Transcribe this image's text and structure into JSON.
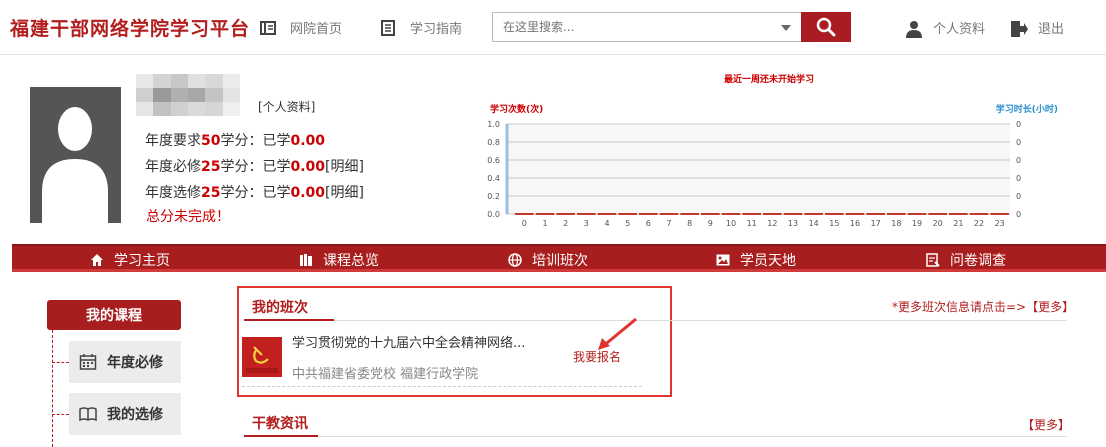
{
  "header": {
    "site_title": "福建干部网络学院学习平台",
    "nav": [
      {
        "label": "网院首页",
        "icon": "book-icon"
      },
      {
        "label": "学习指南",
        "icon": "guide-icon"
      }
    ],
    "search": {
      "placeholder": "在这里搜索...",
      "value": ""
    },
    "profile_label": "个人资料",
    "logout_label": "退出"
  },
  "profile": {
    "profile_link": "[个人资料]",
    "annual_required_prefix": "年度要求",
    "annual_required_value": "50",
    "annual_required_mid": "学分：已学",
    "annual_required_done": "0.00",
    "compulsory_prefix": "年度必修",
    "compulsory_value": "25",
    "compulsory_mid": "学分：已学",
    "compulsory_done": "0.00",
    "compulsory_detail": "[明细]",
    "elective_prefix": "年度选修",
    "elective_value": "25",
    "elective_mid": "学分：已学",
    "elective_done": "0.00",
    "elective_detail": "[明细]",
    "warning": "总分未完成！"
  },
  "chart_data": {
    "type": "bar",
    "title": "最近一周还未开始学习",
    "ylabel_left": "学习次数(次)",
    "ylabel_right": "学习时长(小时)",
    "categories": [
      "0",
      "1",
      "2",
      "3",
      "4",
      "5",
      "6",
      "7",
      "8",
      "9",
      "10",
      "11",
      "12",
      "13",
      "14",
      "15",
      "16",
      "17",
      "18",
      "19",
      "20",
      "21",
      "22",
      "23"
    ],
    "series": [
      {
        "values": [
          0,
          0,
          0,
          0,
          0,
          0,
          0,
          0,
          0,
          0,
          0,
          0,
          0,
          0,
          0,
          0,
          0,
          0,
          0,
          0,
          0,
          0,
          0,
          0
        ],
        "color": "#c0392b"
      }
    ],
    "y_left_ticks": [
      "1.0",
      "0.8",
      "0.6",
      "0.4",
      "0.2",
      "0.0"
    ],
    "y_right_ticks": [
      "0",
      "0",
      "0",
      "0",
      "0",
      "0"
    ],
    "ylim": [
      0,
      1
    ],
    "grid": true
  },
  "menu": [
    {
      "label": "学习主页",
      "icon": "home-icon"
    },
    {
      "label": "课程总览",
      "icon": "books-icon"
    },
    {
      "label": "培训班次",
      "icon": "globe-icon"
    },
    {
      "label": "学员天地",
      "icon": "photo-icon"
    },
    {
      "label": "问卷调查",
      "icon": "survey-icon"
    }
  ],
  "sidebar": {
    "title": "我的课程",
    "items": [
      {
        "label": "年度必修",
        "icon": "calendar-icon"
      },
      {
        "label": "我的选修",
        "icon": "open-book-icon"
      }
    ]
  },
  "my_class": {
    "title": "我的班次",
    "more_hint": "*更多班次信息请点击=>【更多】",
    "course_title": "学习贯彻党的十九届六中全会精神网络...",
    "course_org": "中共福建省委党校 福建行政学院",
    "enroll_label": "我要报名"
  },
  "news": {
    "title": "干教资讯",
    "more": "【更多】"
  },
  "colors": {
    "brand": "#a81e1e",
    "accent_red": "#c00"
  }
}
